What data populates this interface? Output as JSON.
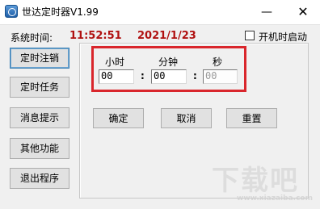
{
  "window": {
    "title": "世达定时器V1.99",
    "minimize_glyph": "—",
    "close_glyph": "✕"
  },
  "status": {
    "system_time_label": "系统时间:",
    "time": "11:52:51",
    "date": "2021/1/23"
  },
  "startup_checkbox": {
    "label": "开机时启动",
    "checked": false
  },
  "sidebar": {
    "buttons": [
      {
        "label": "定时注销"
      },
      {
        "label": "定时任务"
      },
      {
        "label": "消息提示"
      },
      {
        "label": "其他功能"
      },
      {
        "label": "退出程序"
      }
    ]
  },
  "time_panel": {
    "hour_label": "小时",
    "minute_label": "分钟",
    "second_label": "秒",
    "hour_value": "00",
    "minute_value": "00",
    "second_value": "00",
    "separator1": ":",
    "separator2": ":"
  },
  "actions": {
    "confirm_label": "确定",
    "cancel_label": "取消",
    "reset_label": "重置"
  },
  "watermark": {
    "text": "下载吧",
    "sub": "www.xiazaiba.com"
  },
  "colors": {
    "time_color": "#b01010",
    "highlight": "#d9262c"
  }
}
